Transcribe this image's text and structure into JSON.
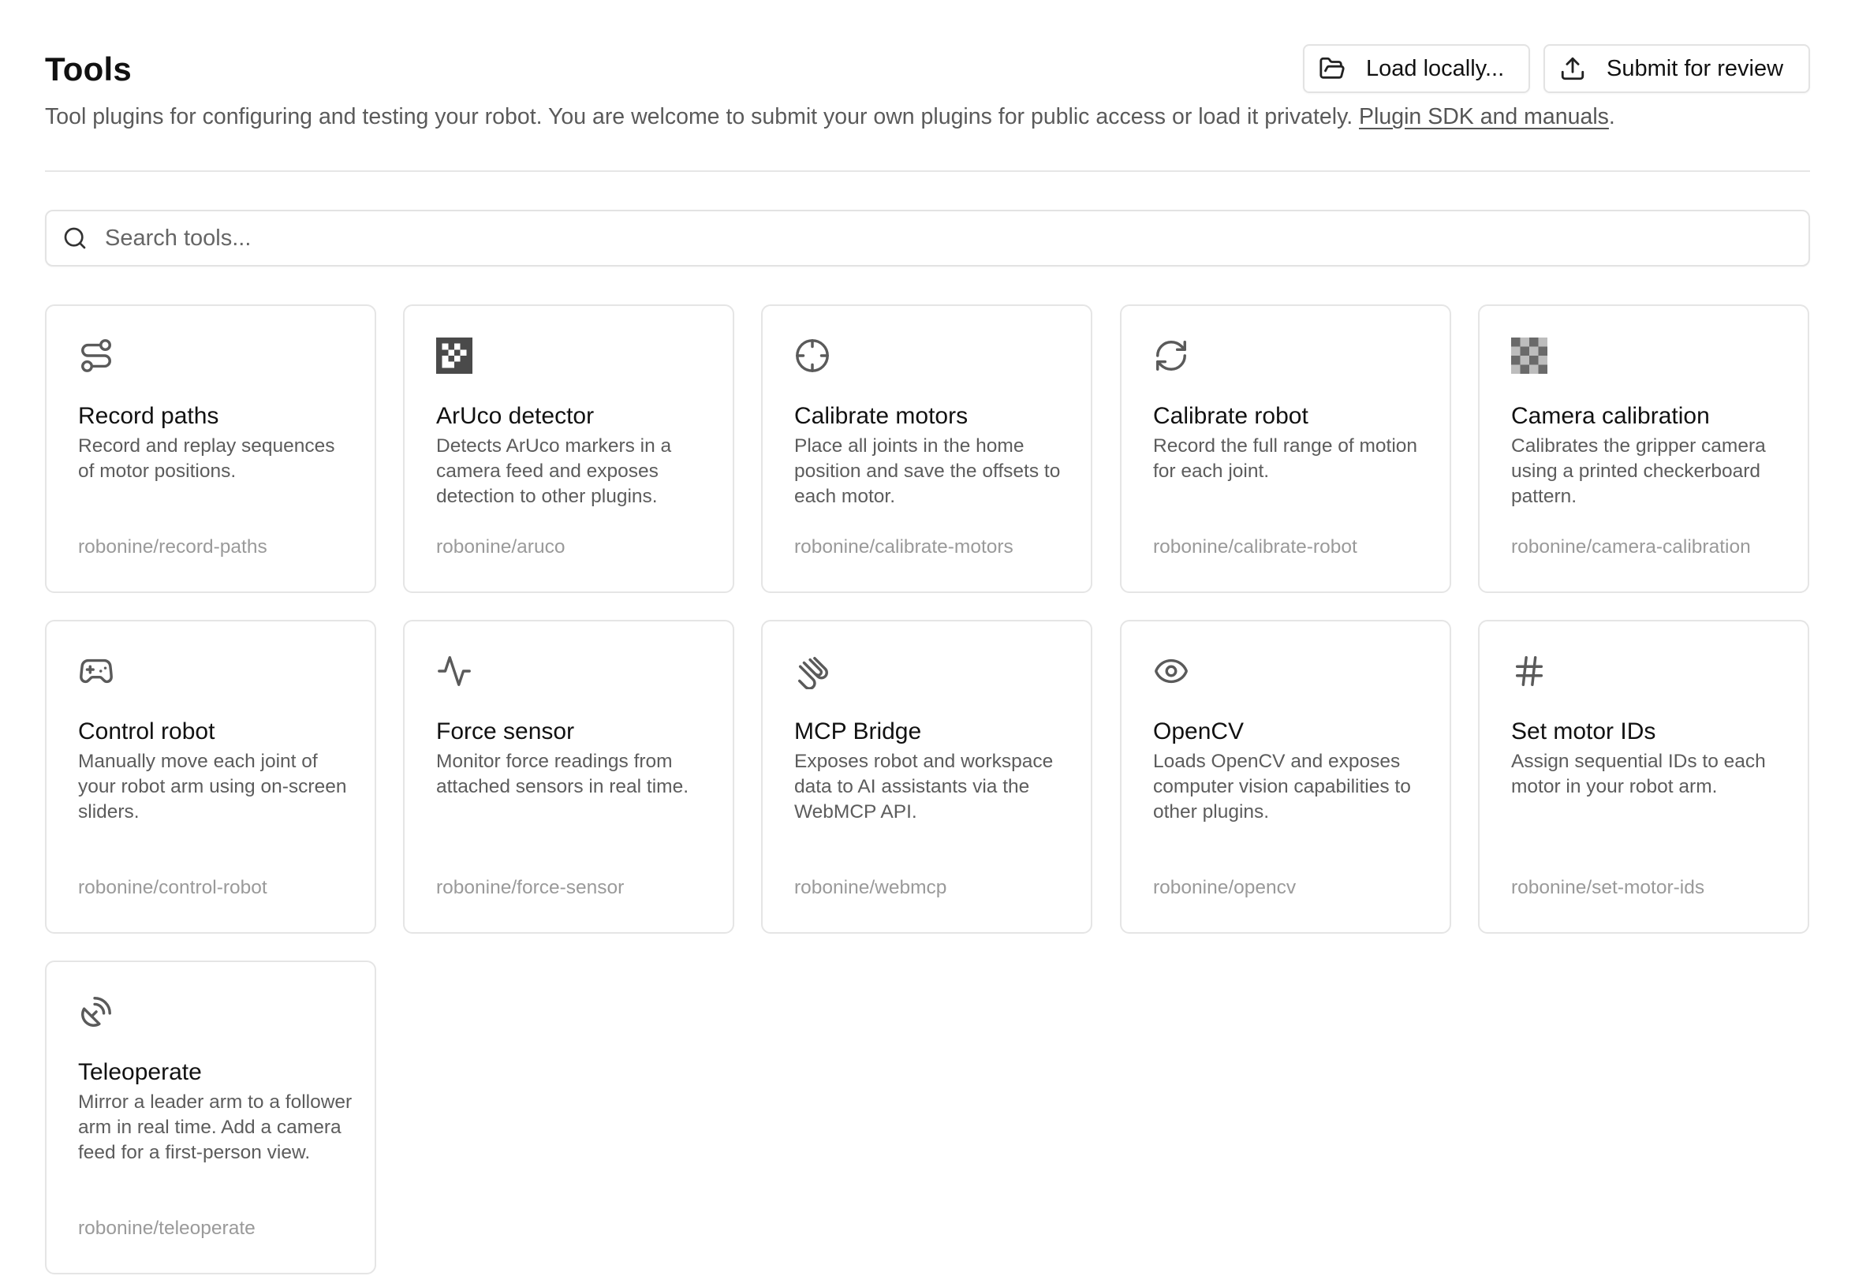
{
  "header": {
    "title": "Tools",
    "description": "Tool plugins for configuring and testing your robot. You are welcome to submit your own plugins for public access or load it privately.",
    "link_label": "Plugin SDK and manuals",
    "link_suffix": ".",
    "buttons": {
      "load_label": "Load locally...",
      "load_icon": "folder-open-icon",
      "submit_label": "Submit for review",
      "submit_icon": "upload-icon"
    }
  },
  "search": {
    "placeholder": "Search tools...",
    "value": "",
    "icon": "search-icon"
  },
  "colors": {
    "icon": "#5a5a5a",
    "border": "#e5e5e5",
    "muted_text": "#9a9a9a"
  },
  "tools": [
    {
      "title": "Record paths",
      "description": "Record and replay sequences of motor positions.",
      "package": "robonine/record-paths",
      "icon": "route-icon"
    },
    {
      "title": "ArUco detector",
      "description": "Detects ArUco markers in a camera feed and exposes detection to other plugins.",
      "package": "robonine/aruco",
      "icon": "aruco-marker-icon"
    },
    {
      "title": "Calibrate motors",
      "description": "Place all joints in the home position and save the offsets to each motor.",
      "package": "robonine/calibrate-motors",
      "icon": "crosshair-icon"
    },
    {
      "title": "Calibrate robot",
      "description": "Record the full range of motion for each joint.",
      "package": "robonine/calibrate-robot",
      "icon": "refresh-icon"
    },
    {
      "title": "Camera calibration",
      "description": "Calibrates the gripper camera using a printed checkerboard pattern.",
      "package": "robonine/camera-calibration",
      "icon": "checkerboard-icon"
    },
    {
      "title": "Control robot",
      "description": "Manually move each joint of your robot arm using on-screen sliders.",
      "package": "robonine/control-robot",
      "icon": "gamepad-icon"
    },
    {
      "title": "Force sensor",
      "description": "Monitor force readings from attached sensors in real time.",
      "package": "robonine/force-sensor",
      "icon": "activity-icon"
    },
    {
      "title": "MCP Bridge",
      "description": "Exposes robot and workspace data to AI assistants via the WebMCP API.",
      "package": "robonine/webmcp",
      "icon": "paperclip-icon"
    },
    {
      "title": "OpenCV",
      "description": "Loads OpenCV and exposes computer vision capabilities to other plugins.",
      "package": "robonine/opencv",
      "icon": "eye-icon"
    },
    {
      "title": "Set motor IDs",
      "description": "Assign sequential IDs to each motor in your robot arm.",
      "package": "robonine/set-motor-ids",
      "icon": "hash-icon"
    },
    {
      "title": "Teleoperate",
      "description": "Mirror a leader arm to a follower arm in real time. Add a camera feed for a first-person view.",
      "package": "robonine/teleoperate",
      "icon": "satellite-dish-icon"
    }
  ]
}
